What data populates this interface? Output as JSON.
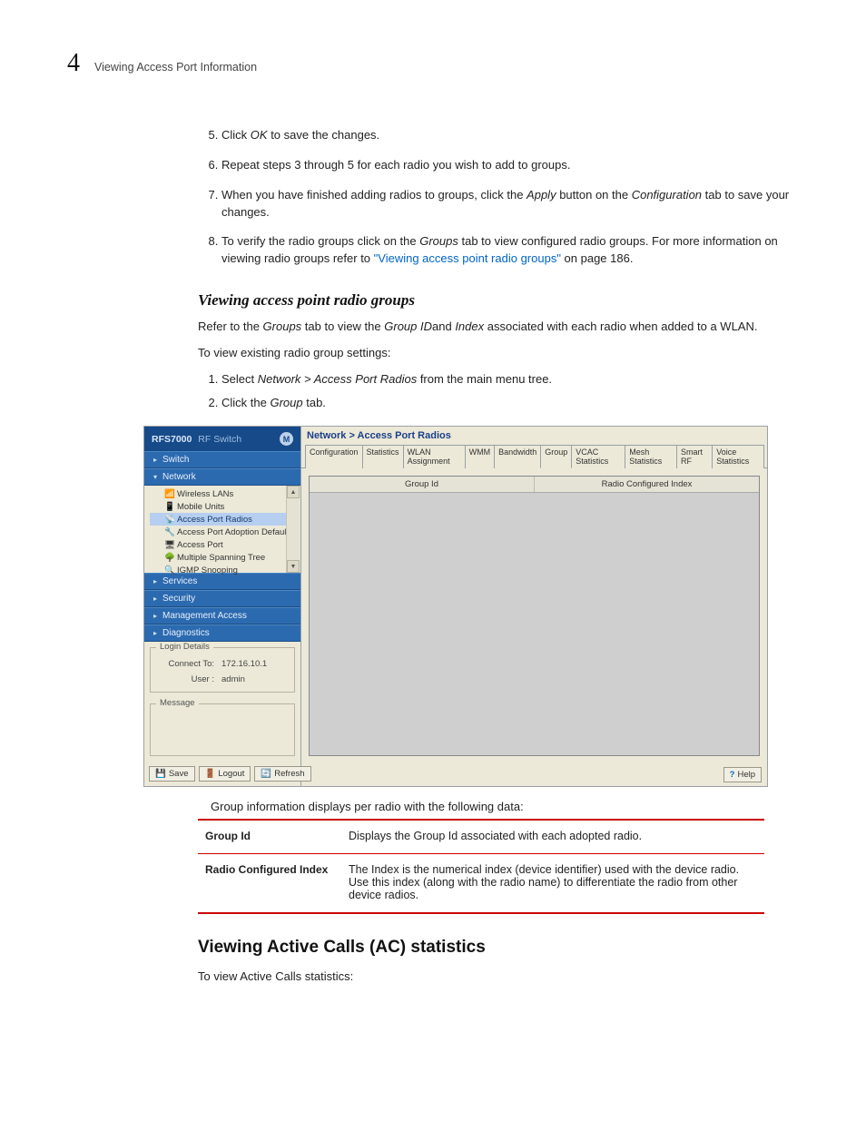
{
  "header": {
    "section_number": "4",
    "section_title": "Viewing Access Port Information"
  },
  "steps_a": {
    "start": 5,
    "items": [
      {
        "pre": "Click ",
        "em": "OK",
        "post": " to save the changes."
      },
      {
        "pre": "Repeat steps 3 through 5 for each radio you wish to add to groups.",
        "em": "",
        "post": ""
      },
      {
        "pre": "When you have finished adding radios to groups, click the ",
        "em": "Apply",
        "mid": " button on the ",
        "em2": "Configuration",
        "post": " tab to save your changes."
      },
      {
        "pre": "To verify the radio groups click on the ",
        "em": "Groups",
        "mid": " tab to view configured radio groups. For more information on viewing radio groups refer to ",
        "link": "\"Viewing access point radio groups\"",
        "post2": " on page 186."
      }
    ]
  },
  "subheading1": "Viewing access point radio groups",
  "para1_a": "Refer to the ",
  "para1_em1": "Groups",
  "para1_b": " tab to view the ",
  "para1_em2": "Group ID",
  "para1_c": "and ",
  "para1_em3": "Index",
  "para1_d": " associated with each radio when added to a WLAN.",
  "para2": "To view existing radio group settings:",
  "steps_b": [
    {
      "pre": "Select ",
      "em": "Network > Access Port Radios",
      "post": " from the main menu tree."
    },
    {
      "pre": "Click the ",
      "em": "Group",
      "post": " tab."
    }
  ],
  "screenshot": {
    "brand_name": "RFS7000",
    "brand_sub": "RF Switch",
    "nav": [
      "Switch",
      "Network",
      "Services",
      "Security",
      "Management Access",
      "Diagnostics"
    ],
    "tree": [
      "Wireless LANs",
      "Mobile Units",
      "Access Port Radios",
      "Access Port Adoption Defaults",
      "Access Port",
      "Multiple Spanning Tree",
      "IGMP Snooping"
    ],
    "login_box_label": "Login Details",
    "login_connect_k": "Connect To:",
    "login_connect_v": "172.16.10.1",
    "login_user_k": "User :",
    "login_user_v": "admin",
    "message_label": "Message",
    "btn_save": "Save",
    "btn_logout": "Logout",
    "btn_refresh": "Refresh",
    "breadcrumb": "Network > Access Port Radios",
    "tabs": [
      "Configuration",
      "Statistics",
      "WLAN Assignment",
      "WMM",
      "Bandwidth",
      "Group",
      "VCAC Statistics",
      "Mesh Statistics",
      "Smart RF",
      "Voice Statistics"
    ],
    "active_tab_index": 5,
    "col1": "Group Id",
    "col2": "Radio Configured Index",
    "help_label": "Help"
  },
  "caption": "Group information displays per radio with the following data:",
  "defs": [
    {
      "k": "Group Id",
      "v": "Displays the Group Id associated with each adopted radio."
    },
    {
      "k": "Radio Configured Index",
      "v": "The Index is the numerical index (device identifier) used with the device radio. Use this index (along with the radio name) to differentiate the radio from other device radios."
    }
  ],
  "heading2": "Viewing Active Calls (AC) statistics",
  "para3": "To view Active Calls statistics:"
}
